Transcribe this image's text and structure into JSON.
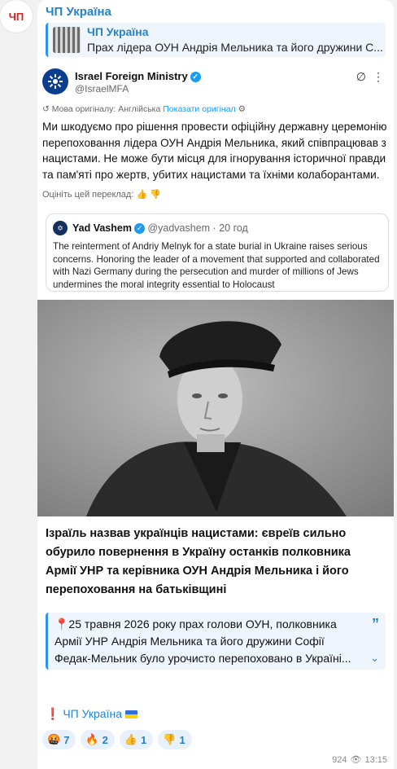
{
  "channel": {
    "name": "ЧП Україна",
    "avatar_text": "ЧП"
  },
  "reply": {
    "title": "ЧП Україна",
    "text": "Прах лідера ОУН Андрія Мельника та його дружини С..."
  },
  "tweet": {
    "name": "Israel Foreign Ministry",
    "handle": "@IsraelMFA",
    "translated_label": "Мова оригіналу: Англійська",
    "show_original": "Показати оригінал",
    "body": "Ми шкодуємо про рішення провести офіційну державну церемонію перепоховання лідера ОУН Андрія Мельника, який співпрацював з нацистами. Не може бути місця для ігнорування історичної правди та пам'яті про жертв, убитих нацистами та їхніми колаборантами.",
    "rate_label": "Оцініть цей переклад:",
    "quote": {
      "name": "Yad Vashem",
      "handle": "@yadvashem",
      "time": "20 год",
      "body": "The reinterment of Andriy Melnyk for a state burial in Ukraine raises serious concerns. Honoring the leader of a movement that supported and collaborated with Nazi Germany during the persecution and murder of millions of Jews undermines the moral integrity essential to Holocaust"
    }
  },
  "headline": "Ізраїль назвав українців нацистами: євреїв сильно обурило повернення в Україну останків полковника Армії УНР та керівника ОУН Андрія Мельника і його перепоховання на батьківщині",
  "blockquote": {
    "text": "📍25 травня 2026 року прах голови ОУН, полковника Армії УНР Андрія Мельника та його дружини Софії Федак-Мельник було урочисто перепоховано в Україні..."
  },
  "signature": {
    "mark": "❗",
    "text": "ЧП Україна"
  },
  "reactions": [
    {
      "emoji": "🤬",
      "count": "7"
    },
    {
      "emoji": "🔥",
      "count": "2"
    },
    {
      "emoji": "👍",
      "count": "1"
    },
    {
      "emoji": "👎",
      "count": "1"
    }
  ],
  "meta": {
    "views": "924",
    "time": "13:15"
  }
}
